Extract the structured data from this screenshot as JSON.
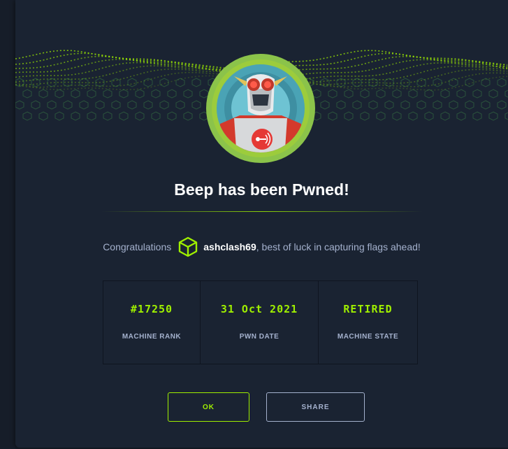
{
  "modal": {
    "title": "Beep has been Pwned!",
    "congrats_lead": "Congratulations",
    "username": "ashclash69",
    "congrats_tail": ", best of luck in capturing flags ahead!"
  },
  "stats": [
    {
      "value": "#17250",
      "label": "MACHINE RANK"
    },
    {
      "value": "31 Oct 2021",
      "label": "PWN DATE"
    },
    {
      "value": "RETIRED",
      "label": "MACHINE STATE"
    }
  ],
  "buttons": {
    "ok": "OK",
    "share": "SHARE"
  },
  "icons": {
    "user": "cube-icon",
    "avatar": "robot-machine-avatar"
  },
  "colors": {
    "accent": "#9fef00",
    "background": "#1a2332",
    "muted_text": "#a4b1cd"
  }
}
